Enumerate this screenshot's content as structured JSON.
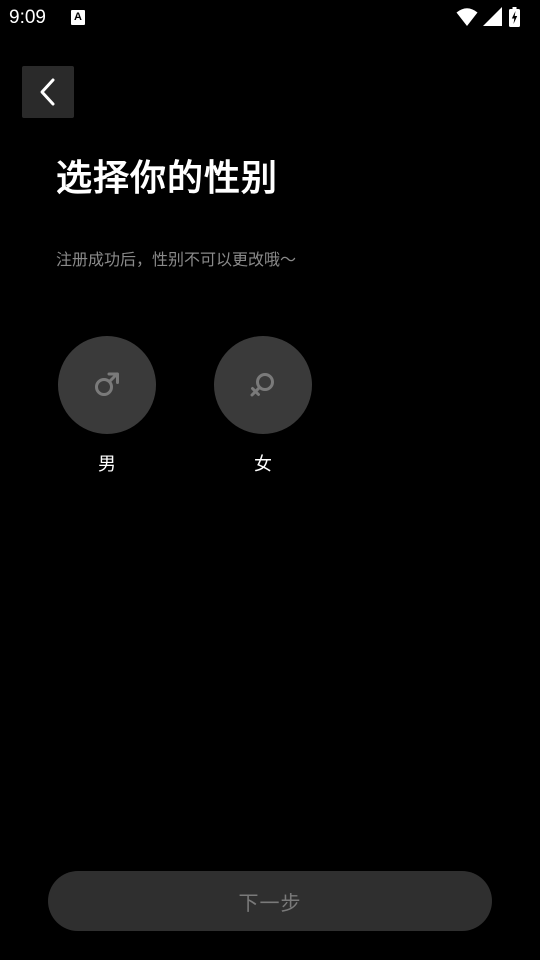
{
  "status_bar": {
    "time": "9:09",
    "a_icon_text": "A",
    "icons": [
      "wifi-icon",
      "signal-icon",
      "battery-charging-icon"
    ]
  },
  "header": {
    "back_icon": "chevron-left-icon",
    "title": "选择你的性别",
    "subtitle": "注册成功后，性别不可以更改哦～"
  },
  "gender_options": [
    {
      "id": "male",
      "label": "男",
      "icon": "male-symbol-icon"
    },
    {
      "id": "female",
      "label": "女",
      "icon": "female-symbol-icon"
    }
  ],
  "footer": {
    "next_label": "下一步"
  },
  "colors": {
    "background": "#000000",
    "back_button_bg": "#2a2a2a",
    "option_circle_bg": "#3a3a3a",
    "icon_gray": "#7a7a7a",
    "subtitle_gray": "#8a8a8a",
    "next_button_bg": "#2f2f2f",
    "next_button_text": "#7a7a7a"
  }
}
